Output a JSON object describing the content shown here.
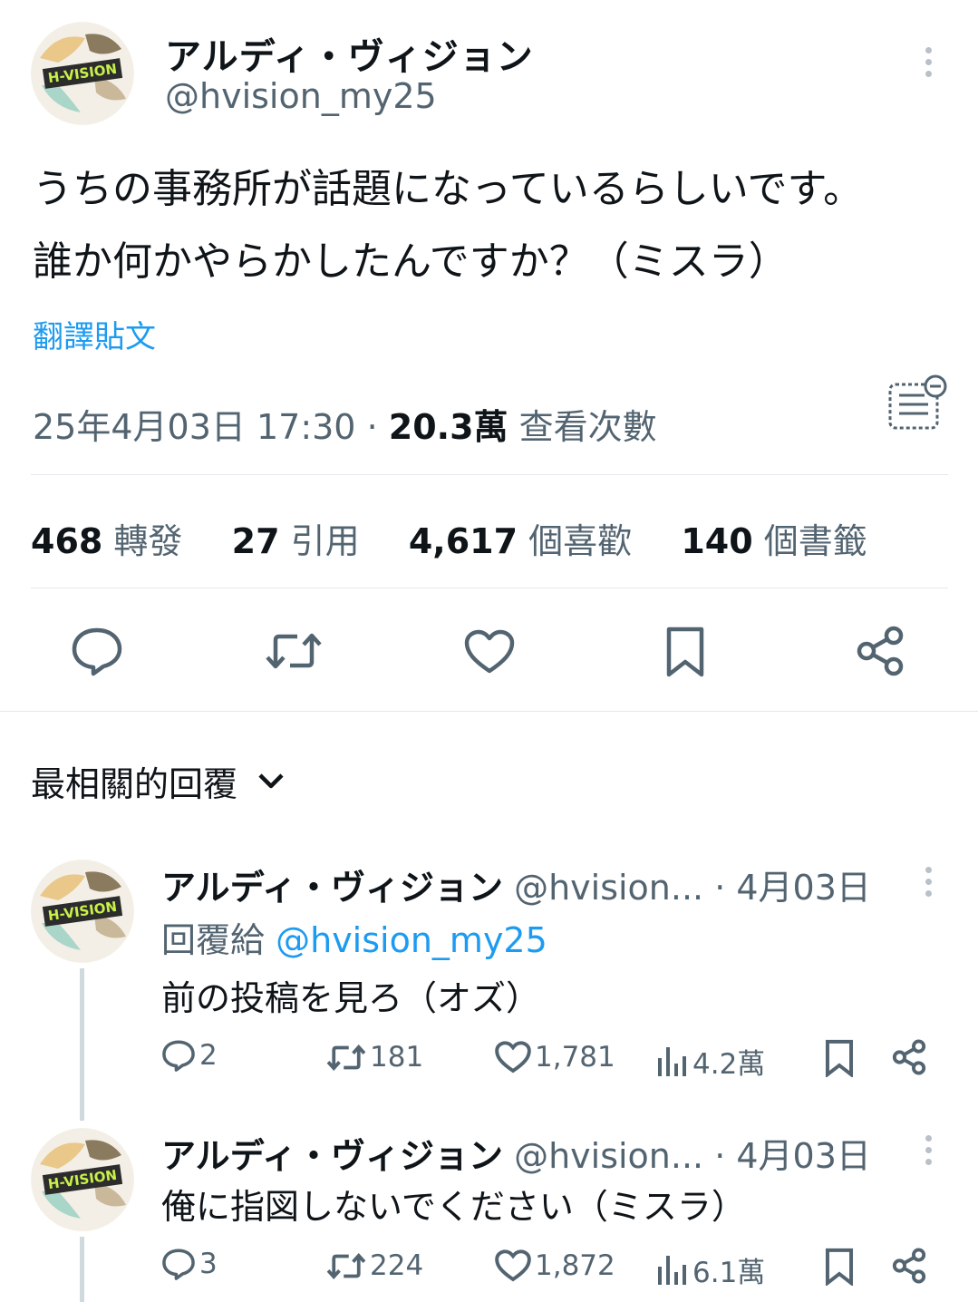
{
  "tweet": {
    "author_name": "アルディ・ヴィジョン",
    "author_handle": "@hvision_my25",
    "text_line1": "うちの事務所が話題になっているらしいです。",
    "text_line2": "誰か何かやらかしたんですか？（ミスラ）",
    "translate_label": "翻譯貼文",
    "timestamp": "25年4月03日 17:30",
    "separator": "·",
    "views_count": "20.3萬",
    "views_label": "查看次數",
    "stats": [
      {
        "num": "468",
        "label": "轉發"
      },
      {
        "num": "27",
        "label": "引用"
      },
      {
        "num": "4,617",
        "label": "個喜歡"
      },
      {
        "num": "140",
        "label": "個書籤"
      }
    ]
  },
  "replies_header": {
    "sort_label": "最相關的回覆"
  },
  "replies": [
    {
      "author_name": "アルディ・ヴィジョン",
      "author_handle": "@hvision...",
      "date": "· 4月03日",
      "reply_to_label": "回覆給",
      "reply_to_handle": "@hvision_my25",
      "text": "前の投稿を見ろ（オズ）",
      "replies": "2",
      "retweets": "181",
      "likes": "1,781",
      "views": "4.2萬"
    },
    {
      "author_name": "アルディ・ヴィジョン",
      "author_handle": "@hvision...",
      "date": "· 4月03日",
      "text": "俺に指図しないでください（ミスラ）",
      "replies": "3",
      "retweets": "224",
      "likes": "1,872",
      "views": "6.1萬"
    }
  ],
  "colors": {
    "accent": "#1d9bf0",
    "secondary_text": "#536471",
    "primary_text": "#0f1419",
    "divider": "#e4e8eb"
  },
  "icons": [
    "more-icon",
    "post-summary-icon",
    "reply-icon",
    "retweet-icon",
    "like-icon",
    "bookmark-icon",
    "share-icon",
    "chevron-down-icon",
    "views-icon"
  ]
}
